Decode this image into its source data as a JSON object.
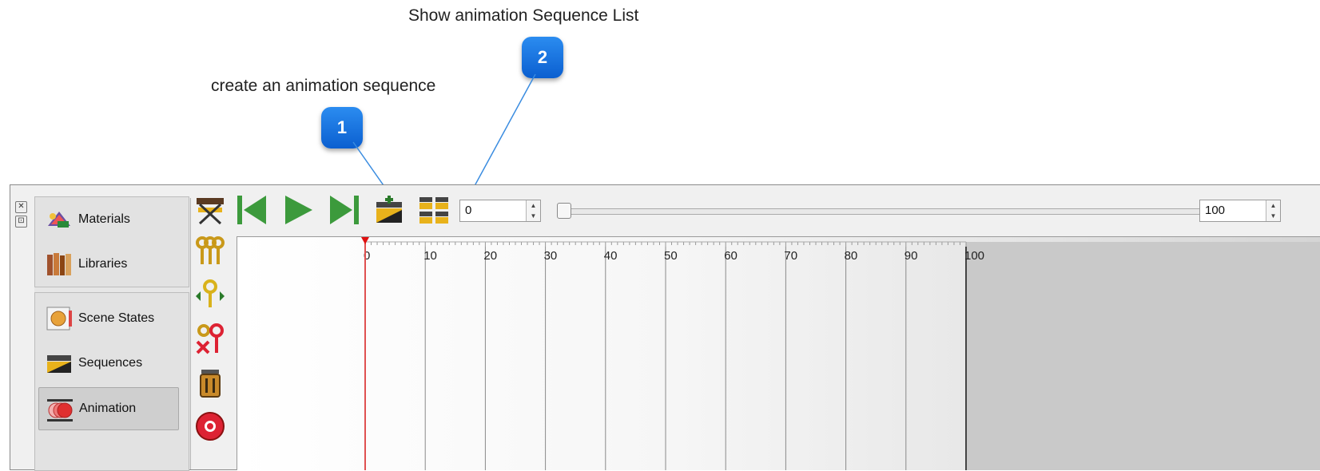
{
  "callouts": [
    {
      "number": "1",
      "text": "create an animation sequence"
    },
    {
      "number": "2",
      "text": "Show animation Sequence List"
    }
  ],
  "sidebar": {
    "top_items": [
      {
        "label": "Materials",
        "icon": "materials-icon"
      },
      {
        "label": "Libraries",
        "icon": "libraries-icon"
      }
    ],
    "bottom_items": [
      {
        "label": "Scene States",
        "icon": "scene-states-icon"
      },
      {
        "label": "Sequences",
        "icon": "sequences-icon"
      },
      {
        "label": "Animation",
        "icon": "animation-icon",
        "active": true
      }
    ]
  },
  "toolbar": {
    "start_frame": "0",
    "end_frame": "100",
    "tools": [
      "director-chair-icon",
      "skip-to-start-icon",
      "play-icon",
      "skip-to-end-icon",
      "create-sequence-icon",
      "sequence-list-icon"
    ]
  },
  "timeline": {
    "ticks": [
      "0",
      "10",
      "20",
      "30",
      "40",
      "50",
      "60",
      "70",
      "80",
      "90",
      "100"
    ],
    "current_frame": 0
  },
  "colors": {
    "badge": "#1a73e8",
    "playhead": "#e05050",
    "accent_yellow": "#e8b21b"
  }
}
